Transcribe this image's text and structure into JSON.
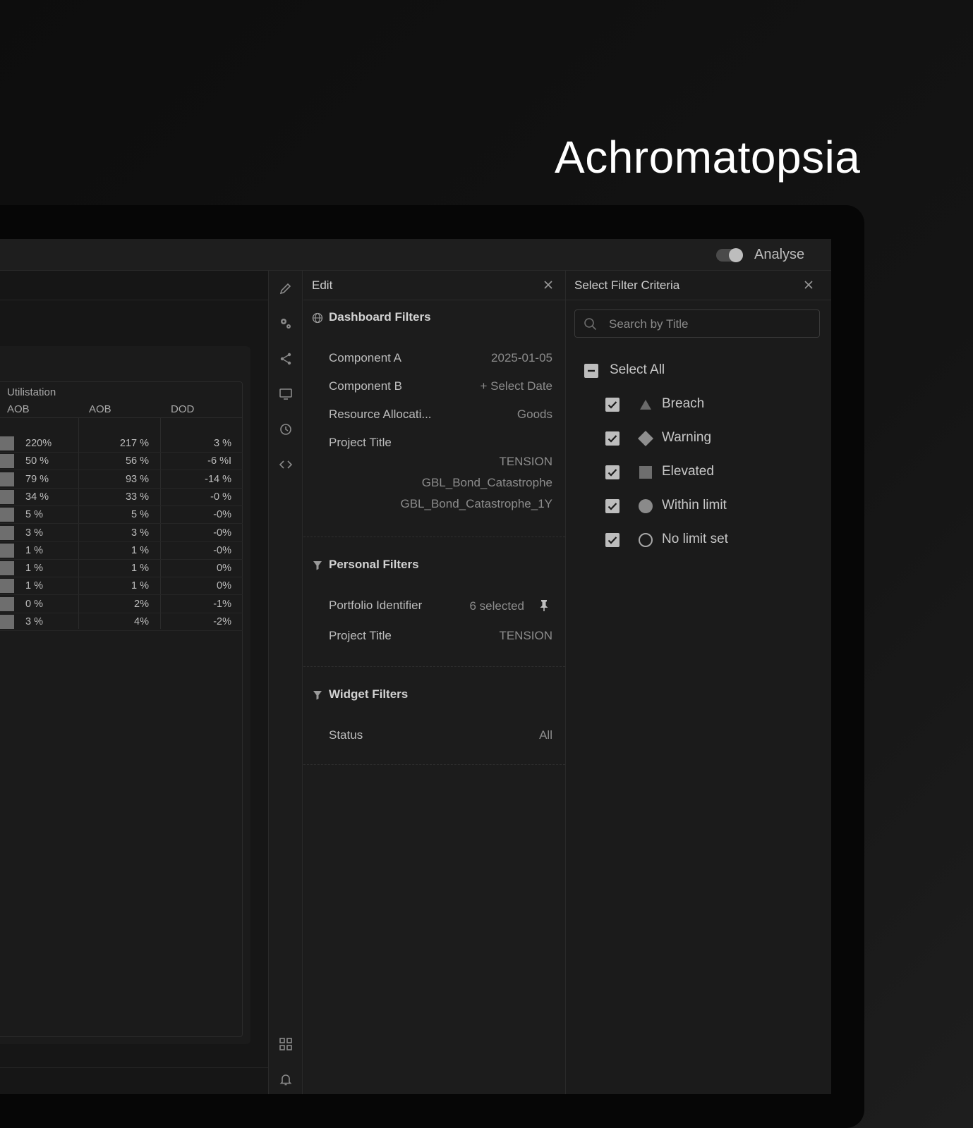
{
  "headline": "Achromatopsia",
  "topbar": {
    "analyse_label": "Analyse",
    "analyse_on": true
  },
  "table": {
    "group_title": "Utilistation",
    "columns": [
      "AOB",
      "AOB",
      "DOD"
    ],
    "rows": [
      [
        "220%",
        "217 %",
        "3 %"
      ],
      [
        "50 %",
        "56 %",
        "-6 %I"
      ],
      [
        "79 %",
        "93 %",
        "-14 %"
      ],
      [
        "34 %",
        "33 %",
        "-0 %"
      ],
      [
        "5 %",
        "5 %",
        "-0%"
      ],
      [
        "3 %",
        "3 %",
        "-0%"
      ],
      [
        "1 %",
        "1 %",
        "-0%"
      ],
      [
        "1 %",
        "1 %",
        "0%"
      ],
      [
        "1 %",
        "1 %",
        "0%"
      ],
      [
        "0 %",
        "2%",
        "-1%"
      ],
      [
        "3 %",
        "4%",
        "-2%"
      ]
    ]
  },
  "rail_icons": [
    "pencil-icon",
    "gears-icon",
    "share-icon",
    "monitor-icon",
    "history-icon",
    "code-icon",
    "grid-icon",
    "bell-icon"
  ],
  "edit_panel": {
    "title": "Edit",
    "dashboard_filters": {
      "title": "Dashboard Filters",
      "component_a_label": "Component A",
      "component_a_value": "2025-01-05",
      "component_b_label": "Component B",
      "component_b_value": "+ Select Date",
      "resource_label": "Resource Allocati...",
      "resource_value": "Goods",
      "project_title_label": "Project Title",
      "project_values": [
        "TENSION",
        "GBL_Bond_Catastrophe",
        "GBL_Bond_Catastrophe_1Y"
      ]
    },
    "personal_filters": {
      "title": "Personal Filters",
      "portfolio_label": "Portfolio Identifier",
      "portfolio_value": "6 selected",
      "project_title_label": "Project Title",
      "project_title_value": "TENSION"
    },
    "widget_filters": {
      "title": "Widget Filters",
      "status_label": "Status",
      "status_value": "All"
    }
  },
  "criteria_panel": {
    "title": "Select Filter Criteria",
    "search_placeholder": "Search by Title",
    "select_all_label": "Select All",
    "items": [
      {
        "label": "Breach",
        "shape": "triangle",
        "checked": true
      },
      {
        "label": "Warning",
        "shape": "diamond",
        "checked": true
      },
      {
        "label": "Elevated",
        "shape": "square",
        "checked": true
      },
      {
        "label": "Within limit",
        "shape": "filled-circle",
        "checked": true
      },
      {
        "label": "No limit set",
        "shape": "hollow-circle",
        "checked": true
      }
    ]
  },
  "colors": {
    "background": "#141414",
    "panel": "#1c1c1c",
    "text": "#bdbdbd",
    "muted_text": "#8c8c8c"
  }
}
